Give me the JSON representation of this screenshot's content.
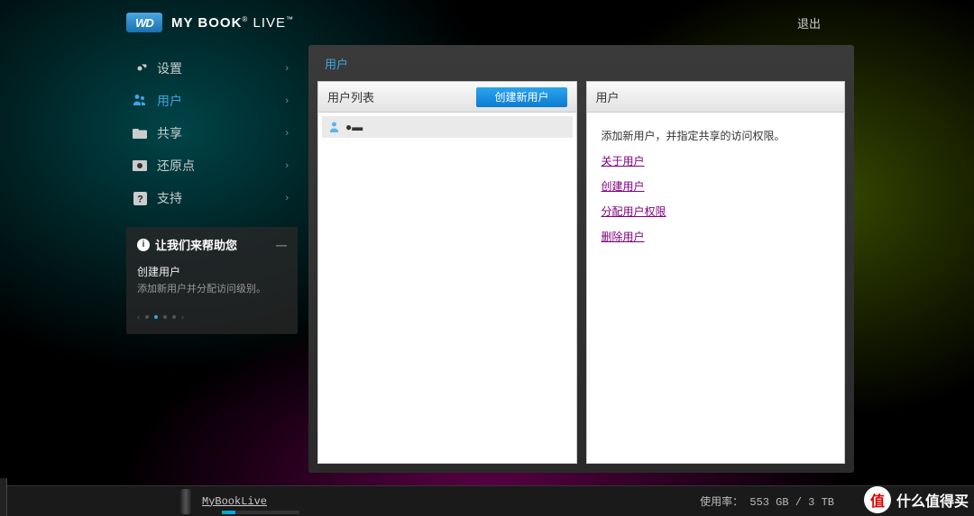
{
  "brand": {
    "bold": "MY BOOK",
    "thin": "LIVE"
  },
  "header": {
    "logout": "退出"
  },
  "nav": {
    "items": [
      {
        "label": "设置"
      },
      {
        "label": "用户"
      },
      {
        "label": "共享"
      },
      {
        "label": "还原点"
      },
      {
        "label": "支持"
      }
    ]
  },
  "help": {
    "title": "让我们来帮助您",
    "subtitle": "创建用户",
    "desc": "添加新用户并分配访问级别。"
  },
  "breadcrumb": "用户",
  "userList": {
    "header": "用户列表",
    "createBtn": "创建新用户",
    "rows": [
      {
        "name": "●▬"
      }
    ]
  },
  "infoCard": {
    "header": "用户",
    "desc": "添加新用户，并指定共享的访问权限。",
    "links": [
      "关于用户",
      "创建用户",
      "分配用户权限",
      "删除用户"
    ]
  },
  "bottom": {
    "driveName": "MyBookLive",
    "usageLabel": "使用率：",
    "usageValue": "553 GB / 3 TB"
  },
  "watermark": "什么值得买"
}
